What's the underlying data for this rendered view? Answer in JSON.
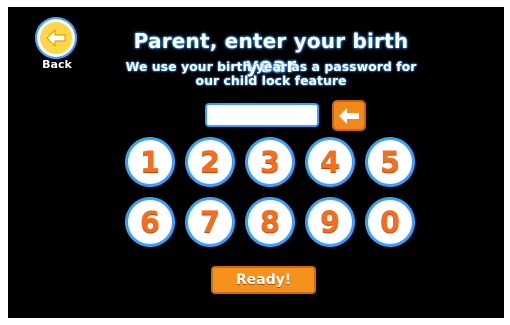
{
  "header": {
    "back_label": "Back",
    "title": "Parent, enter your birth year",
    "subtitle_line1": "We use your birth year as a password for",
    "subtitle_line2": "our child lock feature"
  },
  "pin": {
    "value": ""
  },
  "keypad": {
    "row1": [
      "1",
      "2",
      "3",
      "4",
      "5"
    ],
    "row2": [
      "6",
      "7",
      "8",
      "9",
      "0"
    ]
  },
  "ready_label": "Ready!",
  "colors": {
    "background": "#000000",
    "accent_blue": "#3aa0ff",
    "orange": "#f56d1f",
    "yellow": "#ffd54a"
  },
  "icons": {
    "back": "back-arrow-icon",
    "backspace": "backspace-icon"
  }
}
